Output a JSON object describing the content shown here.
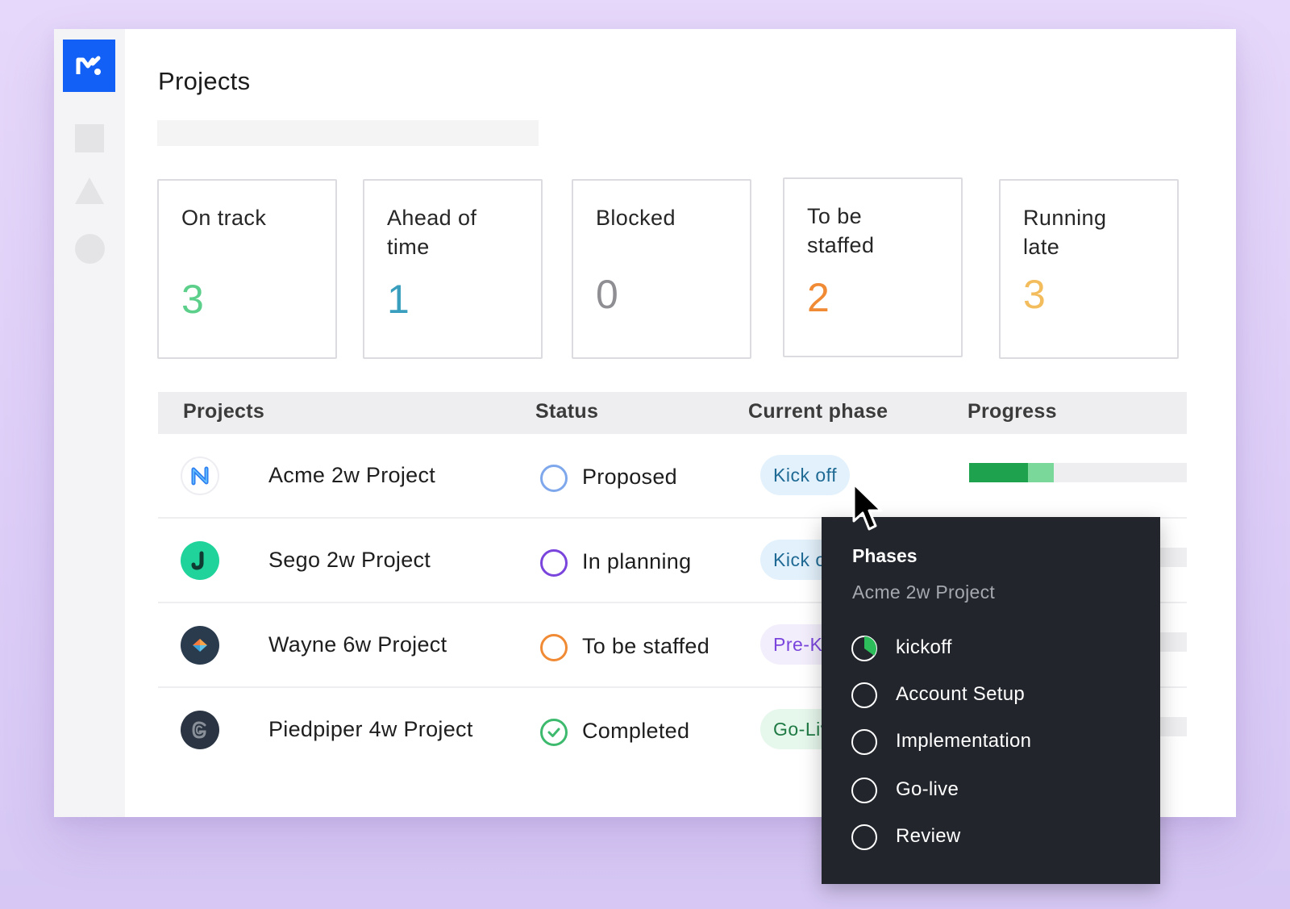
{
  "colors": {
    "brand": "#1260f5",
    "on_track": "#5ccf8a",
    "ahead": "#3a9fbe",
    "blocked": "#8e8e93",
    "to_be_staffed": "#f08a34",
    "running_late": "#f3bd5e"
  },
  "header": {
    "title": "Projects"
  },
  "summary_cards": [
    {
      "label": "On track",
      "value": "3",
      "color": "#5ccf8a"
    },
    {
      "label": "Ahead of time",
      "value": "1",
      "color": "#3a9fbe"
    },
    {
      "label": "Blocked",
      "value": "0",
      "color": "#8e8e93"
    },
    {
      "label": "To be staffed",
      "value": "2",
      "color": "#f08a34"
    },
    {
      "label": "Running late",
      "value": "3",
      "color": "#f3bd5e"
    }
  ],
  "table": {
    "columns": [
      "Projects",
      "Status",
      "Current phase",
      "Progress"
    ],
    "rows": [
      {
        "name": "Acme 2w Project",
        "status": "Proposed",
        "status_color": "#7fa8ec",
        "phase": "Kick off",
        "phase_style": "blue",
        "progress": 0.39,
        "progress_dark": 0.27
      },
      {
        "name": "Sego 2w Project",
        "status": "In planning",
        "status_color": "#7a45dc",
        "phase": "Kick off",
        "phase_style": "blue",
        "progress": 0.0,
        "progress_dark": 0.0
      },
      {
        "name": "Wayne 6w Project",
        "status": "To be staffed",
        "status_color": "#f08a34",
        "phase": "Pre-Kickoff",
        "phase_style": "purple",
        "progress": 0.0,
        "progress_dark": 0.0
      },
      {
        "name": "Piedpiper 4w Project",
        "status": "Completed",
        "status_color": "#3dba6d",
        "phase": "Go-Live",
        "phase_style": "green",
        "progress": 0.0,
        "progress_dark": 0.0
      }
    ]
  },
  "popover": {
    "title": "Phases",
    "subtitle": "Acme 2w Project",
    "items": [
      {
        "label": "kickoff",
        "progress": 0.35
      },
      {
        "label": "Account Setup",
        "progress": 0
      },
      {
        "label": "Implementation",
        "progress": 0
      },
      {
        "label": "Go-live",
        "progress": 0
      },
      {
        "label": "Review",
        "progress": 0
      }
    ]
  },
  "icons": {
    "logo": "brand-logo-icon",
    "cursor": "mouse-pointer-icon",
    "nav": [
      "nav-square-icon",
      "nav-triangle-icon",
      "nav-circle-icon"
    ]
  }
}
